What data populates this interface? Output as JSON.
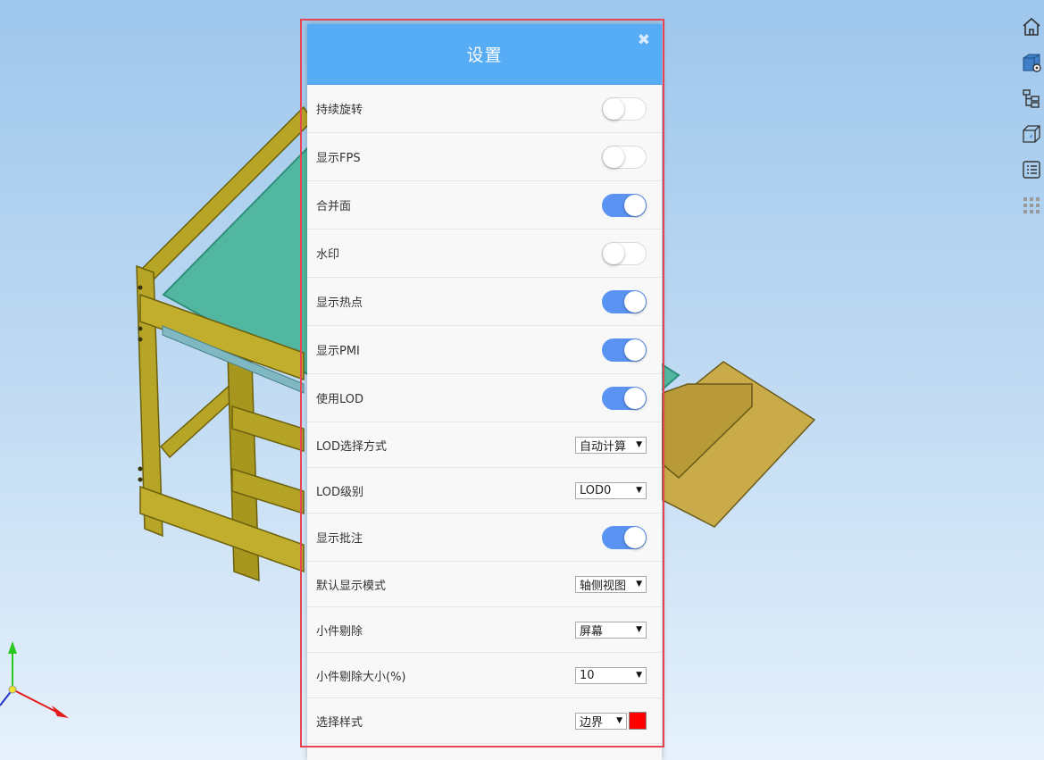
{
  "scene": {
    "model_colors": {
      "frame": "#b7a528",
      "frame_dark": "#8c7d12",
      "glass": "#52b7a0",
      "board": "#c9ab4a"
    },
    "axes": {
      "x_color": "#e31b1b",
      "y_color": "#28c81e",
      "z_color": "#2233cc"
    }
  },
  "toolbar": {
    "items": [
      {
        "icon": "home-icon"
      },
      {
        "icon": "cube-settings-icon"
      },
      {
        "icon": "tree-structure-icon"
      },
      {
        "icon": "cube-transparent-icon"
      },
      {
        "icon": "property-list-icon"
      },
      {
        "icon": "grid-dots-icon"
      }
    ]
  },
  "panel": {
    "title": "设置",
    "close_glyph": "✖",
    "accent": "#57acf6",
    "toggle_on_color": "#5b93f2",
    "rows": [
      {
        "label": "持续旋转",
        "type": "toggle",
        "on": false
      },
      {
        "label": "显示FPS",
        "type": "toggle",
        "on": false
      },
      {
        "label": "合并面",
        "type": "toggle",
        "on": true
      },
      {
        "label": "水印",
        "type": "toggle",
        "on": false
      },
      {
        "label": "显示热点",
        "type": "toggle",
        "on": true
      },
      {
        "label": "显示PMI",
        "type": "toggle",
        "on": true
      },
      {
        "label": "使用LOD",
        "type": "toggle",
        "on": true
      },
      {
        "label": "LOD选择方式",
        "type": "select",
        "value": "自动计算"
      },
      {
        "label": "LOD级别",
        "type": "select",
        "value": "LOD0"
      },
      {
        "label": "显示批注",
        "type": "toggle",
        "on": true
      },
      {
        "label": "默认显示模式",
        "type": "select",
        "value": "轴侧视图"
      },
      {
        "label": "小件剔除",
        "type": "select",
        "value": "屏幕"
      },
      {
        "label": "小件剔除大小(%)",
        "type": "select",
        "value": "10"
      },
      {
        "label": "选择样式",
        "type": "select-color",
        "value": "边界",
        "color": "#ff0000"
      }
    ]
  }
}
